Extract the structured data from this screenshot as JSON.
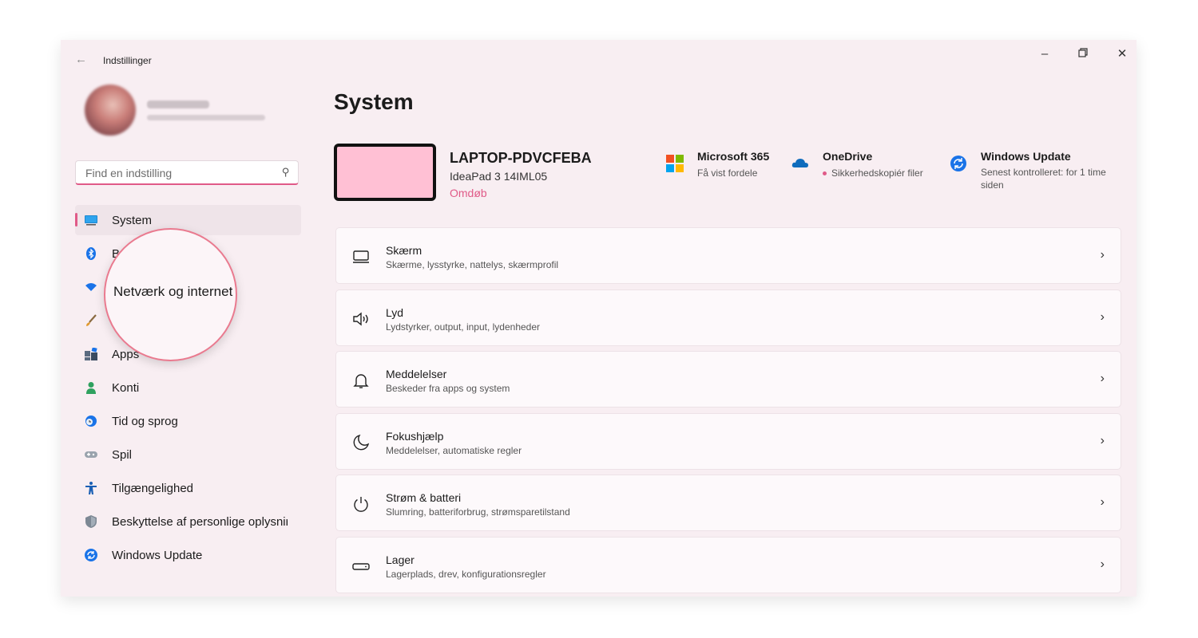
{
  "window": {
    "title": "Indstillinger"
  },
  "search": {
    "placeholder": "Find en indstilling"
  },
  "nav": {
    "items": [
      {
        "label": "System",
        "icon": "monitor-icon"
      },
      {
        "label": "B",
        "icon": "bluetooth-icon"
      },
      {
        "label": "",
        "icon": "wifi-icon"
      },
      {
        "label": "",
        "icon": "brush-icon"
      },
      {
        "label": "Apps",
        "icon": "apps-icon"
      },
      {
        "label": "Konti",
        "icon": "account-icon"
      },
      {
        "label": "Tid og sprog",
        "icon": "globe-clock-icon"
      },
      {
        "label": "Spil",
        "icon": "gamepad-icon"
      },
      {
        "label": "Tilgængelighed",
        "icon": "accessibility-icon"
      },
      {
        "label": "Beskyttelse af personlige oplysnir",
        "icon": "shield-icon"
      },
      {
        "label": "Windows Update",
        "icon": "update-icon"
      }
    ],
    "zoom_label": "Netværk og internet"
  },
  "main": {
    "heading": "System",
    "device": {
      "name": "LAPTOP-PDVCFEBA",
      "model": "IdeaPad 3 14IML05",
      "rename": "Omdøb"
    },
    "tiles": [
      {
        "title": "Microsoft 365",
        "subtitle": "Få vist fordele",
        "icon": "microsoft-logo-icon"
      },
      {
        "title": "OneDrive",
        "subtitle": "Sikkerhedskopiér filer",
        "icon": "onedrive-cloud-icon"
      },
      {
        "title": "Windows Update",
        "subtitle": "Senest kontrolleret: for 1 time siden",
        "icon": "update-icon"
      }
    ],
    "cards": [
      {
        "title": "Skærm",
        "subtitle": "Skærme, lysstyrke, nattelys, skærmprofil",
        "icon": "display-icon"
      },
      {
        "title": "Lyd",
        "subtitle": "Lydstyrker, output, input, lydenheder",
        "icon": "speaker-icon"
      },
      {
        "title": "Meddelelser",
        "subtitle": "Beskeder fra apps og system",
        "icon": "bell-icon"
      },
      {
        "title": "Fokushjælp",
        "subtitle": "Meddelelser, automatiske regler",
        "icon": "moon-icon"
      },
      {
        "title": "Strøm & batteri",
        "subtitle": "Slumring, batteriforbrug, strømsparetilstand",
        "icon": "power-icon"
      },
      {
        "title": "Lager",
        "subtitle": "Lagerplads, drev, konfigurationsregler",
        "icon": "storage-drive-icon"
      }
    ]
  },
  "colors": {
    "accent": "#e05a88",
    "window_bg": "#f8eef2",
    "card_bg": "#fdf9fb",
    "device_screen": "#ffc0d4"
  }
}
